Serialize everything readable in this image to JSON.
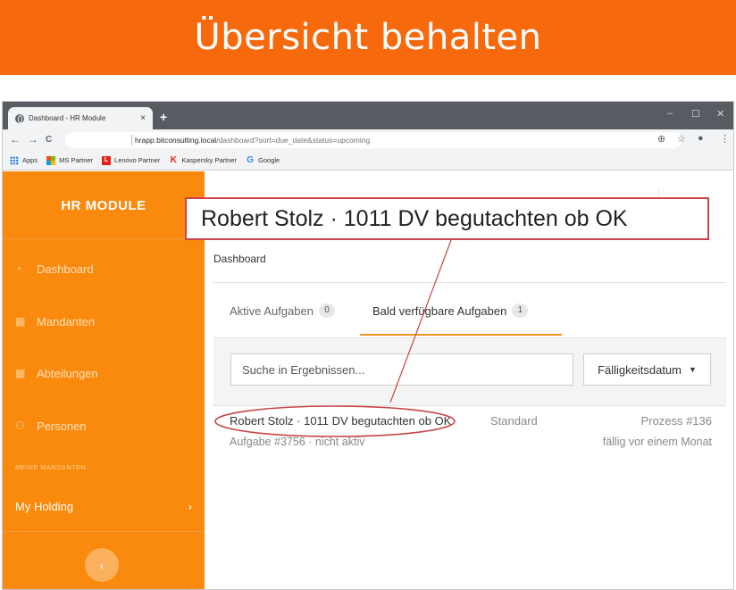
{
  "banner": {
    "title": "Übersicht behalten"
  },
  "browser": {
    "tab_title": "Dashboard - HR Module",
    "tab_close": "×",
    "new_tab": "+",
    "url_host": "hrapp.bitconsulting.local",
    "url_path": "/dashboard?sort=due_date&status=upcoming",
    "bookmarks": [
      "Apps",
      "MS Partner",
      "Lenovo Partner",
      "Kaspersky Partner",
      "Google"
    ],
    "window_controls": [
      "–",
      "☐",
      "✕"
    ],
    "icons": {
      "back": "←",
      "forward": "→",
      "reload": "C",
      "zoom": "⊕",
      "star": "☆",
      "profile": "●",
      "menu": "⋮"
    }
  },
  "sidebar": {
    "brand": "HR MODULE",
    "items": [
      {
        "label": "Dashboard",
        "icon": "dashboard-icon"
      },
      {
        "label": "Mandanten",
        "icon": "building-icon"
      },
      {
        "label": "Abteilungen",
        "icon": "building-icon"
      },
      {
        "label": "Personen",
        "icon": "people-icon"
      }
    ],
    "section_label": "MEINE MANDANTEN",
    "holding": {
      "label": "My Holding",
      "chevron": "›"
    },
    "collapse": "‹"
  },
  "main": {
    "breadcrumb": "Dashboard",
    "tabs": [
      {
        "label": "Aktive Aufgaben",
        "count": "0"
      },
      {
        "label": "Bald verfügbare Aufgaben",
        "count": "1"
      }
    ],
    "search": {
      "placeholder": "Suche in Ergebnissen..."
    },
    "sort": {
      "label": "Fälligkeitsdatum",
      "caret": "▼"
    },
    "task": {
      "title": "Robert Stolz · 1011 DV begutachten ob OK",
      "type": "Standard",
      "process": "Prozess #136",
      "subtitle": "Aufgabe #3756 · nicht aktiv",
      "due": "fällig vor einem Monat"
    }
  },
  "callout": {
    "text": "Robert Stolz · 1011 DV begutachten ob OK"
  },
  "colors": {
    "banner": "#f6690c",
    "sidebar": "#f98a0e",
    "accent": "#f7941d",
    "callout": "#c9454a"
  }
}
